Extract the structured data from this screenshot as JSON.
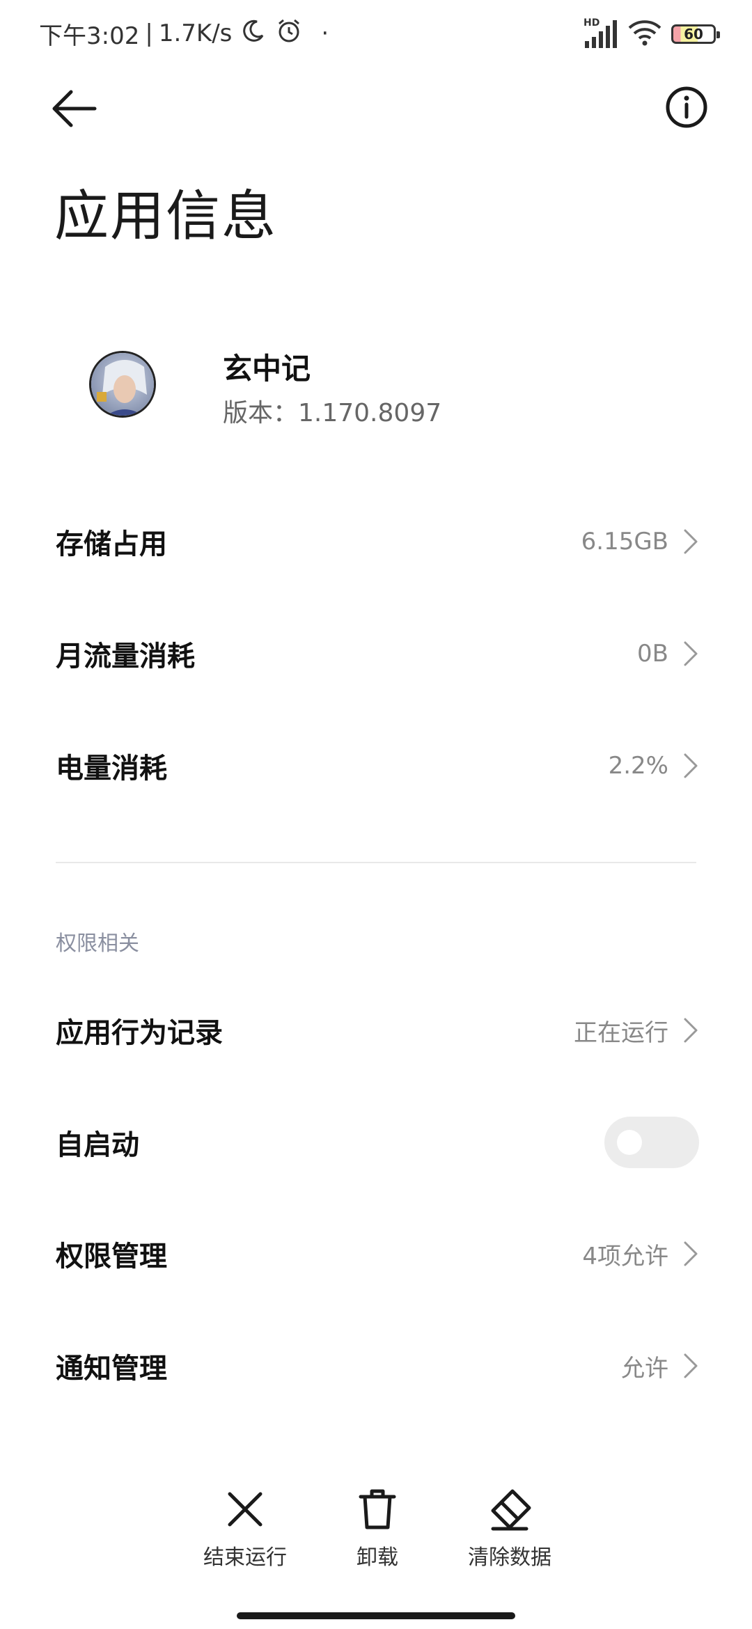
{
  "status_bar": {
    "time": "下午3:02",
    "separator": "|",
    "net_speed": "1.7K/s",
    "extra_dot": "·",
    "network_label": "HD",
    "battery_level": "60",
    "icons": [
      "moon-icon",
      "alarm-icon",
      "signal-icon",
      "wifi-icon",
      "battery-icon"
    ]
  },
  "header": {
    "title": "应用信息",
    "icons": [
      "back-arrow-icon",
      "info-icon"
    ]
  },
  "app": {
    "name": "玄中记",
    "version": "版本：1.170.8097"
  },
  "usage": [
    {
      "label": "存储占用",
      "value": "6.15GB"
    },
    {
      "label": "月流量消耗",
      "value": "0B"
    },
    {
      "label": "电量消耗",
      "value": "2.2%"
    }
  ],
  "permissions_section": {
    "title": "权限相关",
    "behavior_log": {
      "label": "应用行为记录",
      "value": "正在运行"
    },
    "auto_start": {
      "label": "自启动",
      "enabled": false
    },
    "permission_mgmt": {
      "label": "权限管理",
      "value": "4项允许"
    },
    "notification_mgmt": {
      "label": "通知管理",
      "value": "允许"
    }
  },
  "actions": [
    {
      "label": "结束运行",
      "icon": "close-icon"
    },
    {
      "label": "卸载",
      "icon": "trash-icon"
    },
    {
      "label": "清除数据",
      "icon": "eraser-icon"
    }
  ],
  "colors": {
    "background": "#ffffff",
    "primary_text": "#111111",
    "secondary_text": "#888888",
    "section_title": "#8a8fa0",
    "toggle_off": "#ececec"
  }
}
